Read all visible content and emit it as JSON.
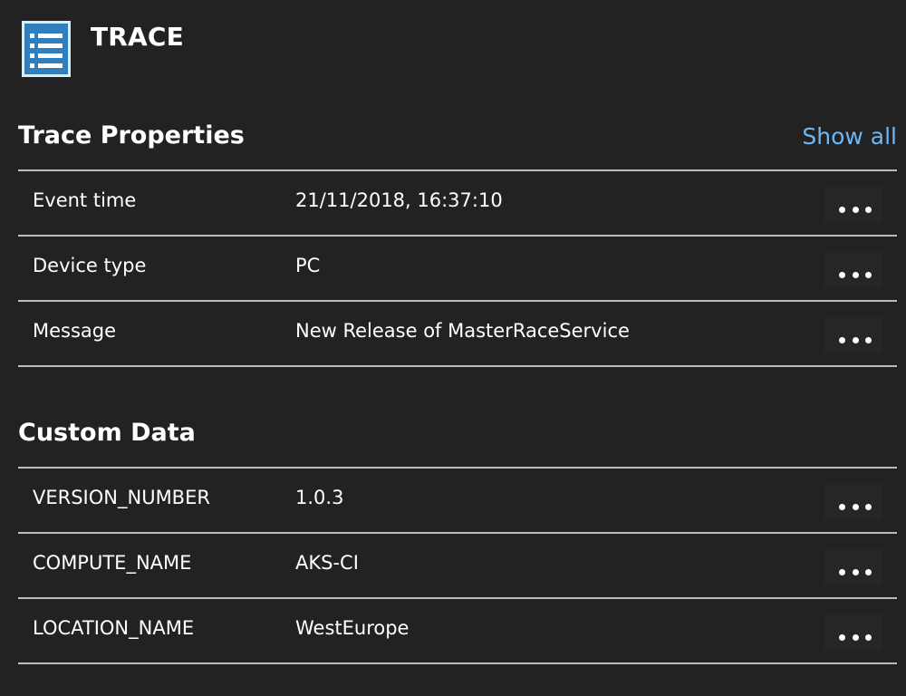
{
  "header": {
    "title": "TRACE",
    "icon": "list-icon"
  },
  "trace_properties": {
    "title": "Trace Properties",
    "show_all_label": "Show all",
    "rows": [
      {
        "key": "Event time",
        "value": "21/11/2018, 16:37:10"
      },
      {
        "key": "Device type",
        "value": "PC"
      },
      {
        "key": "Message",
        "value": "New Release of MasterRaceService"
      }
    ]
  },
  "custom_data": {
    "title": "Custom Data",
    "rows": [
      {
        "key": "VERSION_NUMBER",
        "value": "1.0.3"
      },
      {
        "key": "COMPUTE_NAME",
        "value": "AKS-CI"
      },
      {
        "key": "LOCATION_NAME",
        "value": "WestEurope"
      }
    ]
  },
  "colors": {
    "background": "#222222",
    "text": "#ffffff",
    "link": "#6cb8f6",
    "icon_fill": "#2f7fbf",
    "divider": "#bdbdbd"
  }
}
